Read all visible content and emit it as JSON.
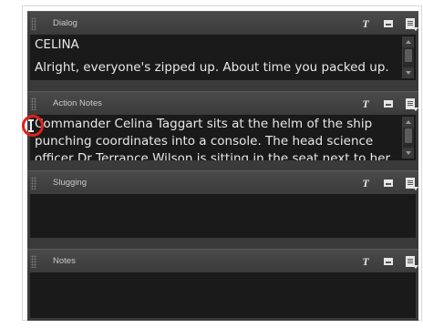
{
  "panels": [
    {
      "title": "Dialog",
      "lines": [
        "CELINA",
        "Alright, everyone's zipped up. About time you packed up."
      ]
    },
    {
      "title": "Action Notes",
      "lines": [
        "Commander Celina Taggart sits at the helm of the ship",
        "punching coordinates into a console. The head science",
        "officer Dr Terrance Wilson is sitting in the seat next to her."
      ]
    },
    {
      "title": "Slugging",
      "lines": []
    },
    {
      "title": "Notes",
      "lines": []
    }
  ],
  "header_icons": [
    "text-format-icon",
    "window-icon",
    "document-menu-icon"
  ],
  "cursor": {
    "type": "text-ibeam-icon",
    "highlight_color": "#e0211b"
  }
}
